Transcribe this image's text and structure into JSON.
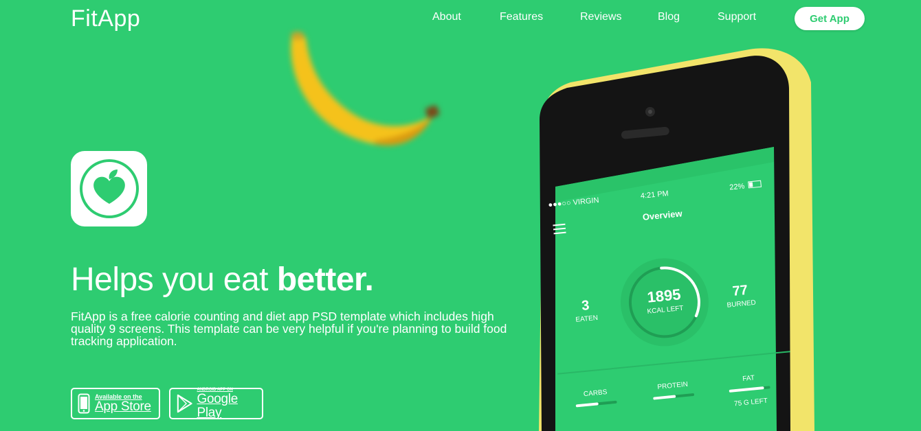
{
  "brand": {
    "name": "FitApp"
  },
  "nav": {
    "items": [
      "About",
      "Features",
      "Reviews",
      "Blog",
      "Support"
    ],
    "cta": "Get App"
  },
  "hero": {
    "headline_light": "Helps you eat ",
    "headline_bold": "better.",
    "description": "FitApp is a free calorie counting and diet app PSD template which includes high quality 9 screens. This template can be very helpful if you're planning to build food tracking application."
  },
  "stores": {
    "appstore_small": "Available on the",
    "appstore_big": "App Store",
    "play_small": "ANDROID APP ON",
    "play_big": "Google Play"
  },
  "phone_screen": {
    "carrier": "●●●○○ VIRGIN",
    "time": "4:21 PM",
    "battery": "22%",
    "title": "Overview",
    "eaten_value": "3",
    "eaten_label": "EATEN",
    "kcal_value": "1895",
    "kcal_label": "KCAL LEFT",
    "burned_value": "77",
    "burned_label": "BURNED",
    "ring_progress": 0.33,
    "macros": [
      {
        "label": "CARBS",
        "progress": 0.55
      },
      {
        "label": "PROTEIN",
        "progress": 0.55
      },
      {
        "label": "FAT",
        "progress": 0.85,
        "note": "75 G LEFT"
      }
    ]
  },
  "colors": {
    "background": "#2ecc71",
    "phone_body": "#f2e46a",
    "banana": "#f5c21b"
  }
}
